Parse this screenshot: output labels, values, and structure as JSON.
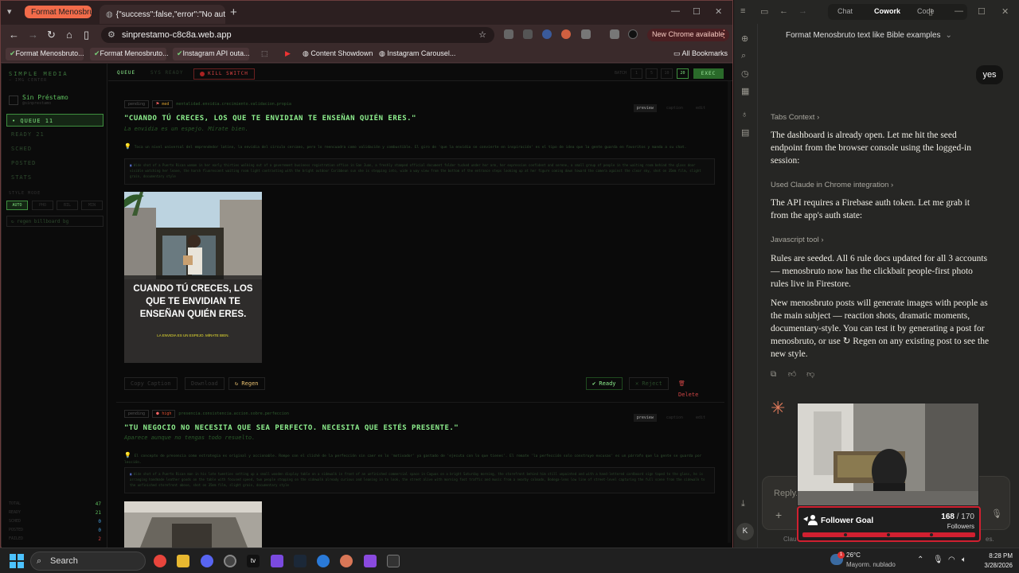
{
  "browser": {
    "tabs": [
      {
        "label": "Format Menosbrutc"
      },
      {
        "label": "{\"success\":false,\"error\":\"No auth"
      }
    ],
    "url": "sinprestamo-c8c8a.web.app",
    "new_chrome": "New Chrome available",
    "bookmarks": [
      "Format Menosbruto...",
      "Format Menosbruto...",
      "Instagram API outa...",
      "",
      "",
      "Content Showdown",
      "Instagram Carousel...",
      "All Bookmarks"
    ]
  },
  "app": {
    "brand": "SIMPLE MEDIA",
    "brand_sub": "— IMG CENTER",
    "account": {
      "name": "Sin Préstamo",
      "handle": "@sinprestamo"
    },
    "nav": [
      "• QUEUE 11",
      "READY 21",
      "SCHED",
      "POSTED",
      "STATS"
    ],
    "style_label": "STYLE MODE",
    "styles": [
      "AUTO",
      "PHO",
      "BIL",
      "MIN"
    ],
    "regen_billboard": "↻ regen billboard bg",
    "stats": [
      {
        "label": "TOTAL",
        "value": "47",
        "color": "#5dbf5d"
      },
      {
        "label": "READY",
        "value": "21",
        "color": "#5dbf5d"
      },
      {
        "label": "SCHED",
        "value": "0",
        "color": "#4aa0e0"
      },
      {
        "label": "POSTED",
        "value": "0",
        "color": "#4aa0e0"
      },
      {
        "label": "FAILED",
        "value": "2",
        "color": "#d44"
      }
    ],
    "topbar": {
      "tab_queue": "QUEUE",
      "tab_ready": "SYS READY",
      "kill_switch": "KILL SWITCH",
      "batch_label": "BATCH",
      "batch_options": [
        "1",
        "5",
        "10",
        "20"
      ],
      "exec": "EXEC"
    },
    "cards": [
      {
        "status": "pending",
        "priority": "med",
        "rule": "mentalidad.envidia.crecimiento.validacion.propia",
        "tabs": [
          "preview",
          "caption",
          "edit"
        ],
        "headline": "\"CUANDO TÚ CRECES, LOS QUE TE ENVIDIAN TE ENSEÑAN QUIÉN ERES.\"",
        "subline": "La envidia es un espejo. Mírate bien.",
        "insight": "Toca un nivel universal del emprendedor latino, la envidia del círculo cercano, pero lo reencuadra como validación y combustible. El giro de 'que la envidia se convierte en inspiración' es el tipo de idea que la gente guarda en favoritos y manda a su chat.",
        "prompt": "Wide shot of a Puerto Rican woman in her early thirties walking out of a government business registration office in San Juan, a freshly stamped official document folder tucked under her arm, her expression confident and serene, a small group of people in the waiting room behind the glass door visible watching her leave, the harsh fluorescent waiting room light contrasting with the bright outdoor Caribbean sun she is stepping into, wide a way view from the bottom of the entrance steps looking up at her figure coming down toward the camera against the clear sky, shot on 35mm film, slight grain, documentary style",
        "image_text": "CUANDO TÚ CRECES, LOS QUE TE ENVIDIAN TE ENSEÑAN QUIÉN ERES.",
        "image_sub": "LA ENVIDIA ES UN ESPEJO. MÍRATE BIEN.",
        "actions": {
          "copy": "Copy Caption",
          "download": "Download",
          "regen": "↻ Regen",
          "ready": "✔ Ready",
          "reject": "✕ Reject",
          "delete": "🗑 Delete"
        }
      },
      {
        "status": "pending",
        "priority": "high",
        "rule": "presencia.consistencia.accion.sobre.perfeccion",
        "tabs": [
          "preview",
          "caption",
          "edit"
        ],
        "headline": "\"TU NEGOCIO NO NECESITA QUE SEA PERFECTO. NECESITA QUE ESTÉS PRESENTE.\"",
        "subline": "Aparece aunque no tengas todo resuelto.",
        "insight": "El concepto de presencia como estrategia es original y accionable. Rompe con el clíché de la perfección sin caer en lo 'motivador' ya gastado de 'ejecuta con lo que tienes'. El remate 'la perfección solo construye excusas' es un párrafo que la gente se guarda por lección.",
        "prompt": "Wide shot of a Puerto Rican man in his late twenties setting up a small wooden display table on a sidewalk in front of an unfinished commercial space in Caguas on a bright Saturday morning, the storefront behind him still unpainted and with a hand-lettered cardboard sign taped to the glass, he is arranging handmade leather goods on the table with focused speed, two people stopping on the sidewalk already curious and leaning in to look, the street alive with morning foot traffic and music from a nearby colmado, Bodega-lens low line of street-level capturing the full scene from the sidewalk to the unfinished storefront above, shot on 35mm film, slight grain, documentary style"
      }
    ]
  },
  "claude": {
    "modes": [
      "Chat",
      "Cowork",
      "Code"
    ],
    "chat_title": "Format Menosbruto text like Bible examples",
    "user_msg": "yes",
    "tools": [
      "Tabs Context",
      "Used Claude in Chrome integration",
      "Javascript tool"
    ],
    "paras": [
      "The dashboard is already open. Let me hit the seed endpoint from the browser console using the logged-in session:",
      "The API requires a Firebase auth token. Let me grab it from the app's auth state:",
      "Rules are seeded. All 6 rule docs updated for all 3 accounts — menosbruto now has the clickbait people-first photo rules live in Firestore.",
      "New menosbruto posts will generate images with people as the main subject — reaction shots, dramatic moments, documentary-style. You can test it by generating a post for menosbruto, or use ↻ Regen on any existing post to see the new style."
    ],
    "reply_placeholder": "Reply...",
    "disclaimer_start": "Clau",
    "disclaimer_end": "es.",
    "avatar": "K"
  },
  "follower": {
    "title": "Follower Goal",
    "current": "168",
    "goal": "/ 170",
    "label": "Followers",
    "progress": 0.988
  },
  "taskbar": {
    "search": "Search",
    "weather_temp": "26°C",
    "weather_desc": "Mayorm. nublado",
    "weather_badge": "1",
    "time": "8:28 PM",
    "date": "3/28/2026"
  }
}
